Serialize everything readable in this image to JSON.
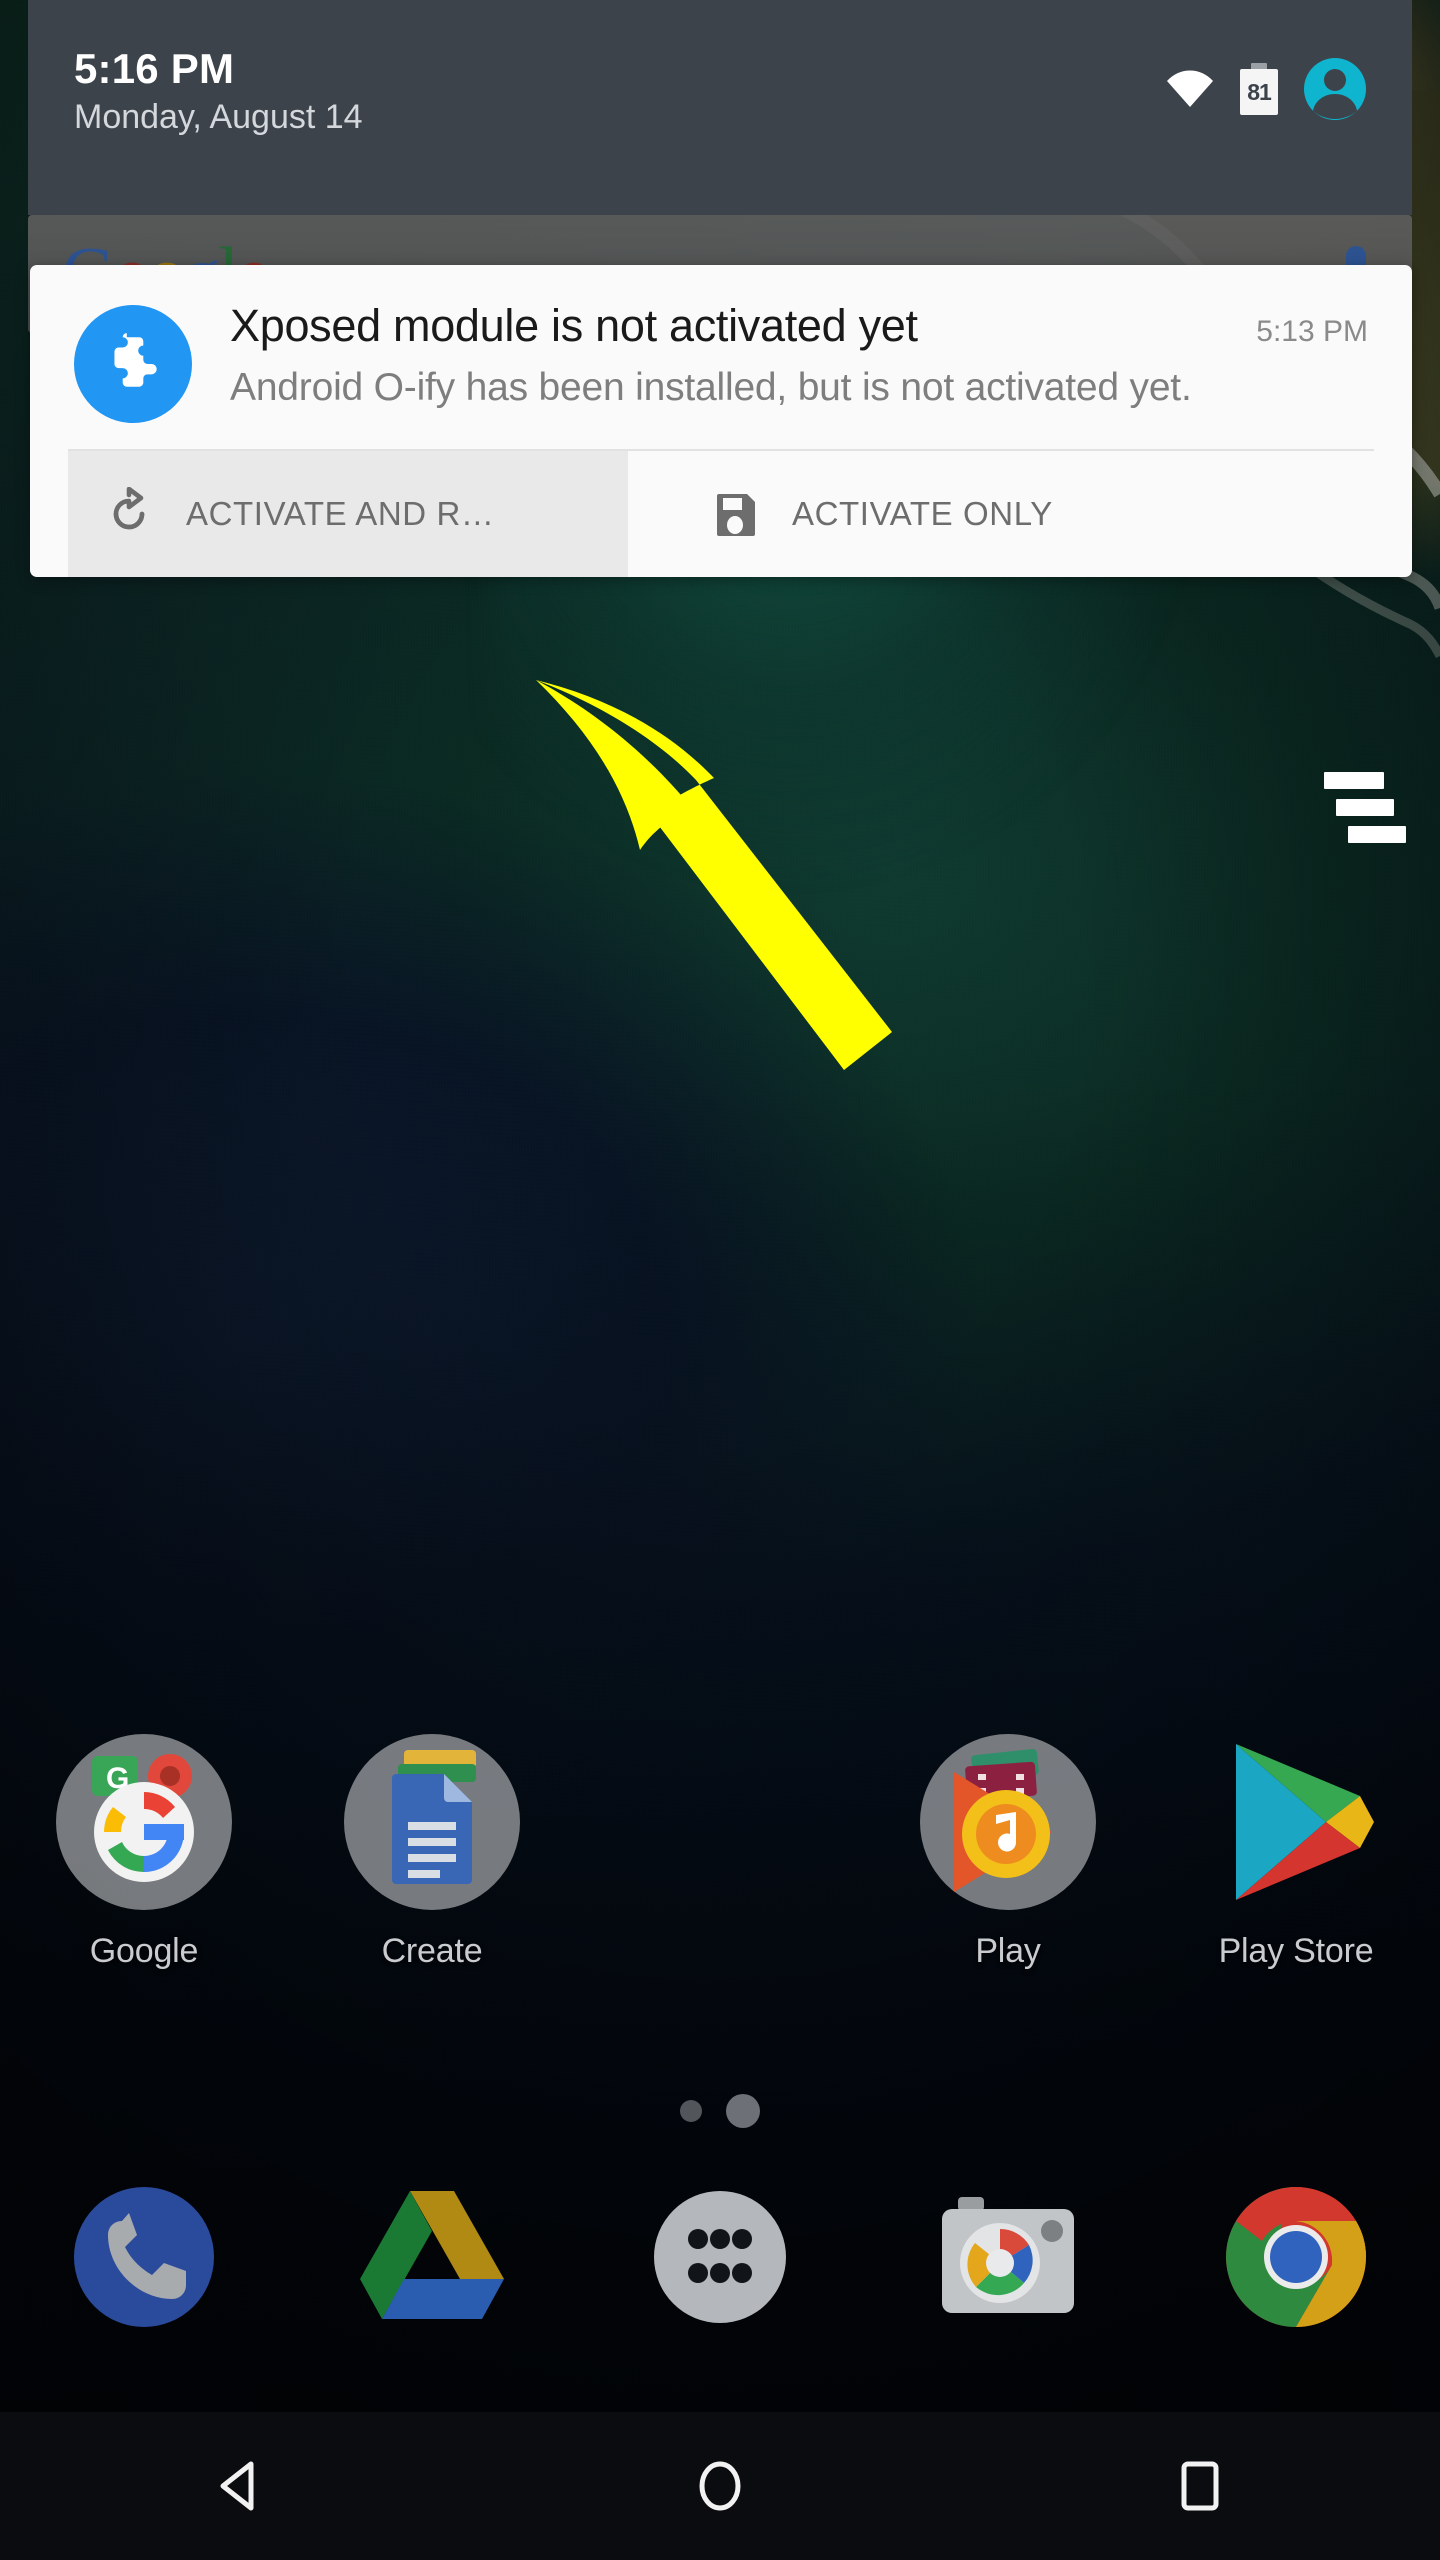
{
  "status_bar": {
    "time": "5:16 PM",
    "date": "Monday, August 14",
    "battery_level": "81",
    "icons": [
      "wifi-icon",
      "battery-icon",
      "user-avatar-icon"
    ],
    "background_color": "#3c434b"
  },
  "search_widget": {
    "brand_letters": [
      "G",
      "o",
      "o",
      "g",
      "l",
      "e"
    ],
    "mic_icon": "microphone-icon"
  },
  "notification": {
    "app_icon": "xposed-puzzle-icon",
    "app_icon_color": "#2196f3",
    "title": "Xposed module is not activated yet",
    "timestamp": "5:13 PM",
    "body": "Android O-ify has been installed, but is not activated yet.",
    "actions": [
      {
        "label": "ACTIVATE AND R…",
        "icon": "refresh-reboot-icon",
        "pressed": true
      },
      {
        "label": "ACTIVATE ONLY",
        "icon": "save-floppy-icon",
        "pressed": false
      }
    ]
  },
  "annotation": {
    "type": "arrow",
    "color": "#ffff00",
    "points_to": "ACTIVATE AND R…"
  },
  "watermark": {
    "name": "three-bars-logo",
    "color": "#ffffff"
  },
  "home_screen": {
    "apps": [
      {
        "label": "Google",
        "icon": "google-folder-icon",
        "is_folder": true
      },
      {
        "label": "Create",
        "icon": "docs-folder-icon",
        "is_folder": true
      },
      {
        "label": "",
        "icon": "empty-slot",
        "is_folder": false
      },
      {
        "label": "Play",
        "icon": "play-folder-icon",
        "is_folder": true
      },
      {
        "label": "Play Store",
        "icon": "play-store-icon",
        "is_folder": false
      }
    ],
    "page_dots": {
      "count": 2,
      "active_index": 1
    },
    "dock": [
      {
        "label": "Phone",
        "icon": "phone-icon"
      },
      {
        "label": "Drive",
        "icon": "google-drive-icon"
      },
      {
        "label": "Apps",
        "icon": "app-drawer-icon"
      },
      {
        "label": "Camera",
        "icon": "camera-icon"
      },
      {
        "label": "Chrome",
        "icon": "chrome-icon"
      }
    ]
  },
  "nav_bar": {
    "buttons": [
      {
        "label": "Back",
        "icon": "back-triangle-icon"
      },
      {
        "label": "Home",
        "icon": "home-circle-icon"
      },
      {
        "label": "Recents",
        "icon": "recents-square-icon"
      }
    ],
    "background_color": "#0a0c10"
  }
}
